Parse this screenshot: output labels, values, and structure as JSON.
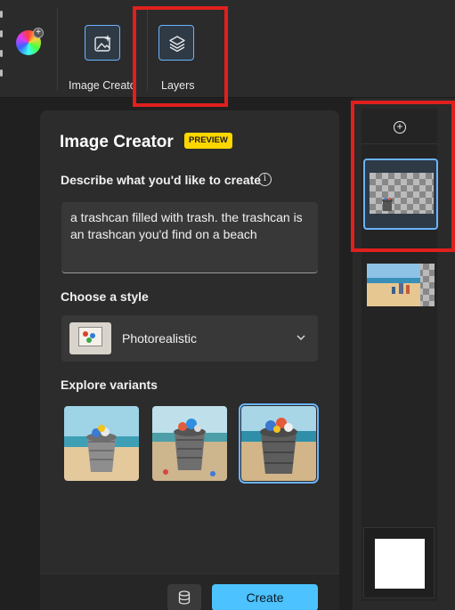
{
  "toolbar": {
    "tools": [
      {
        "label": "Image Creato",
        "icon": "image-sparkle-icon"
      },
      {
        "label": "Layers",
        "icon": "layers-icon"
      }
    ]
  },
  "image_creator": {
    "title": "Image Creator",
    "badge": "PREVIEW",
    "describe_label": "Describe what you'd like to create",
    "prompt_text": "a trashcan filled with trash. the trashcan is an trashcan you'd find on a beach",
    "style_label": "Choose a style",
    "style_value": "Photorealistic",
    "variants_label": "Explore variants",
    "variants_selected_index": 2,
    "create_label": "Create"
  },
  "colors": {
    "accent": "#4cc2ff",
    "selection_border": "#6ab4ff",
    "badge": "#ffd700",
    "highlight": "#e0201e"
  }
}
